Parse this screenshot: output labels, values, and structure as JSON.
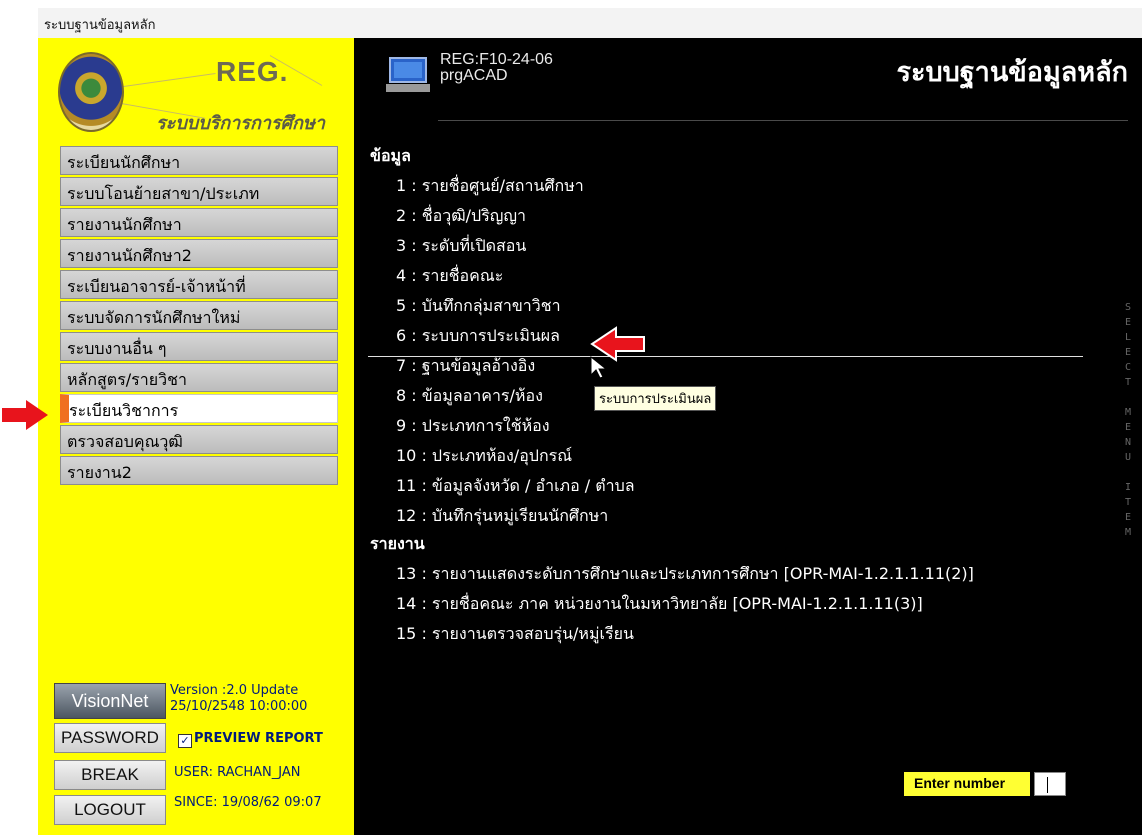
{
  "window": {
    "title": "ระบบฐานข้อมูลหลัก"
  },
  "sidebar": {
    "logo": {
      "reg": "REG.",
      "subtitle": "ระบบบริการการศึกษา"
    },
    "menu": [
      {
        "label": "ระเบียนนักศึกษา"
      },
      {
        "label": "ระบบโอนย้ายสาขา/ประเภท"
      },
      {
        "label": "รายงานนักศึกษา"
      },
      {
        "label": "รายงานนักศึกษา2"
      },
      {
        "label": "ระเบียนอาจารย์-เจ้าหน้าที่"
      },
      {
        "label": "ระบบจัดการนักศึกษาใหม่"
      },
      {
        "label": "ระบบงานอื่น ๆ"
      },
      {
        "label": "หลักสูตร/รายวิชา"
      },
      {
        "label": "ระเบียนวิชาการ",
        "active": true
      },
      {
        "label": "ตรวจสอบคุณวุฒิ"
      },
      {
        "label": "รายงาน2"
      }
    ],
    "brand": "VisionNet",
    "version_line1": "Version :2.0 Update",
    "version_line2": "25/10/2548 10:00:00",
    "password_label": "PASSWORD",
    "break_label": "BREAK",
    "logout_label": "LOGOUT",
    "preview_checked": "✓",
    "preview_label": "PREVIEW REPORT",
    "user": "USER: RACHAN_JAN",
    "since": "SINCE: 19/08/62 09:07"
  },
  "main": {
    "code_line1": "REG:F10-24-06",
    "code_line2": "prgACAD",
    "title": "ระบบฐานข้อมูลหลัก",
    "section_data": "ข้อมูล",
    "items_data": [
      "1 : รายชื่อศูนย์/สถานศึกษา",
      "2 : ชื่อวุฒิ/ปริญญา",
      "3 : ระดับที่เปิดสอน",
      "4 : รายชื่อคณะ",
      "5 : บันทึกกลุ่มสาขาวิชา",
      "6 : ระบบการประเมินผล",
      "7 : ฐานข้อมูลอ้างอิง",
      "8 : ข้อมูลอาคาร/ห้อง",
      "9 : ประเภทการใช้ห้อง",
      "10 : ประเภทห้อง/อุปกรณ์",
      "11 : ข้อมูลจังหวัด / อำเภอ / ตำบล",
      "12 : บันทึกรุ่นหมู่เรียนนักศึกษา"
    ],
    "section_report": "รายงาน",
    "items_report": [
      "13 : รายงานแสดงระดับการศึกษาและประเภทการศึกษา [OPR-MAI-1.2.1.1.11(2)]",
      "14 : รายชื่อคณะ ภาค หน่วยงานในมหาวิทยาลัย [OPR-MAI-1.2.1.1.11(3)]",
      "15 : รายงานตรวจสอบรุ่น/หมู่เรียน"
    ],
    "tooltip": "ระบบการประเมินผล",
    "side_label": "SELECT MENU ITEM",
    "enter_label": "Enter number",
    "enter_value": ""
  },
  "colors": {
    "sidebar_bg": "#ffff00",
    "main_bg": "#000000",
    "active_marker": "#f07020",
    "arrow": "#e8141c"
  }
}
